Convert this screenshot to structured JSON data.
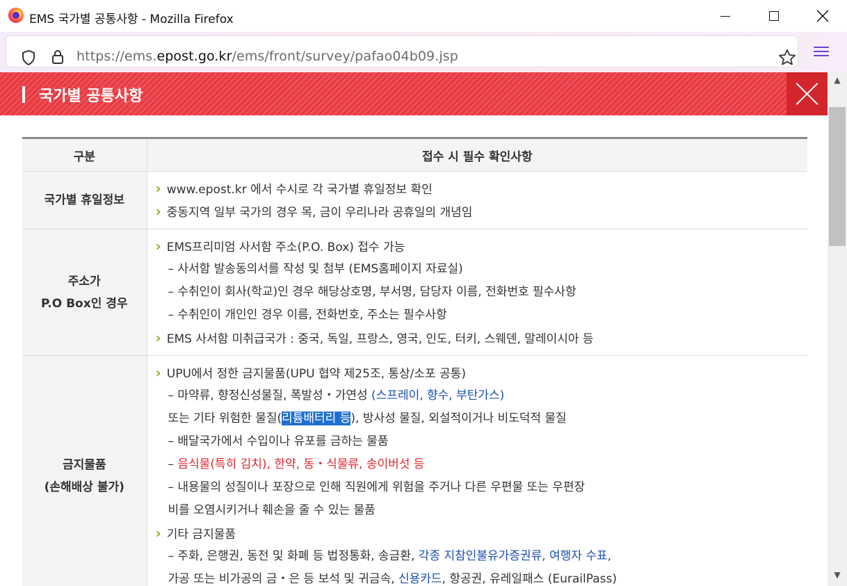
{
  "window": {
    "title": "EMS 국가별 공통사항 - Mozilla Firefox"
  },
  "browser": {
    "url_prefix": "https://ems.",
    "url_domain": "epost.go.kr",
    "url_path": "/ems/front/survey/pafao04b09.jsp"
  },
  "header": {
    "title": "국가별 공통사항"
  },
  "table": {
    "col1": "구분",
    "col2": "접수 시 필수 확인사항",
    "rows": [
      {
        "category_lines": [
          "국가별 휴일정보"
        ],
        "lines": [
          {
            "type": "bullet",
            "text": "www.epost.kr 에서 수시로 각 국가별 휴일정보 확인"
          },
          {
            "type": "bullet",
            "text": "중동지역 일부 국가의 경우 목, 금이 우리나라 공휴일의 개념임"
          }
        ]
      },
      {
        "category_lines": [
          "주소가",
          "P.O Box인 경우"
        ],
        "lines": [
          {
            "type": "bullet",
            "text": "EMS프리미엄 사서함 주소(P.O. Box) 접수 가능"
          },
          {
            "type": "sub",
            "text": "– 사서함 발송동의서를 작성 및 첨부 (EMS홈페이지 자료실)"
          },
          {
            "type": "sub",
            "text": "– 수취인이 회사(학교)인 경우 해당상호명, 부서명, 담당자 이름, 전화번호 필수사항"
          },
          {
            "type": "sub",
            "text": "– 수취인이 개인인 경우 이름, 전화번호, 주소는 필수사항"
          },
          {
            "type": "bullet",
            "text": "EMS 사서함 미취급국가 : 중국, 독일, 프랑스, 영국, 인도, 터키, 스웨덴, 말레이시아 등"
          }
        ]
      },
      {
        "category_lines": [
          "금지물품",
          "(손해배상 불가)"
        ],
        "lines": [
          {
            "type": "bullet",
            "text": "UPU에서 정한 금지물품(UPU 협약 제25조, 통상/소포 공통)"
          },
          {
            "type": "sub",
            "text": "– 마약류, 향정신성물질, 폭발성・가연성 ",
            "blue": "(스프레이, 향수, 부탄가스)"
          },
          {
            "type": "sub",
            "text": "또는 기타 위험한 물질(",
            "selected": "리튬배터리 등",
            "after": "), 방사성 물질, 외설적이거나 비도덕적 물질"
          },
          {
            "type": "sub",
            "text": "– 배달국가에서 수입이나 유포를 금하는 물품"
          },
          {
            "type": "sub",
            "text": "– ",
            "red": "음식물(특히 김치), 한약, 동・식물류, 송이버섯 등"
          },
          {
            "type": "sub",
            "text": "– 내용물의 성질이나 포장으로 인해 직원에게 위험을 주거나 다른 우편물 또는 우편장"
          },
          {
            "type": "sub",
            "text": "비를 오염시키거나 훼손을 줄 수 있는 물품"
          },
          {
            "type": "bullet",
            "text": "기타 금지물품"
          },
          {
            "type": "sub",
            "text": "– 주화, 은행권, 동전 및 화폐 등 법정통화, 송금환, ",
            "blue": "각종 지참인불유가증권류, 여행자 수표,"
          },
          {
            "type": "sub",
            "text": "가공 또는 비가공의 금・은 등 보석 및 귀금속, ",
            "blue": "신용카드",
            "after": ", 항공권, 유레일패스 (EurailPass)"
          }
        ]
      }
    ]
  }
}
